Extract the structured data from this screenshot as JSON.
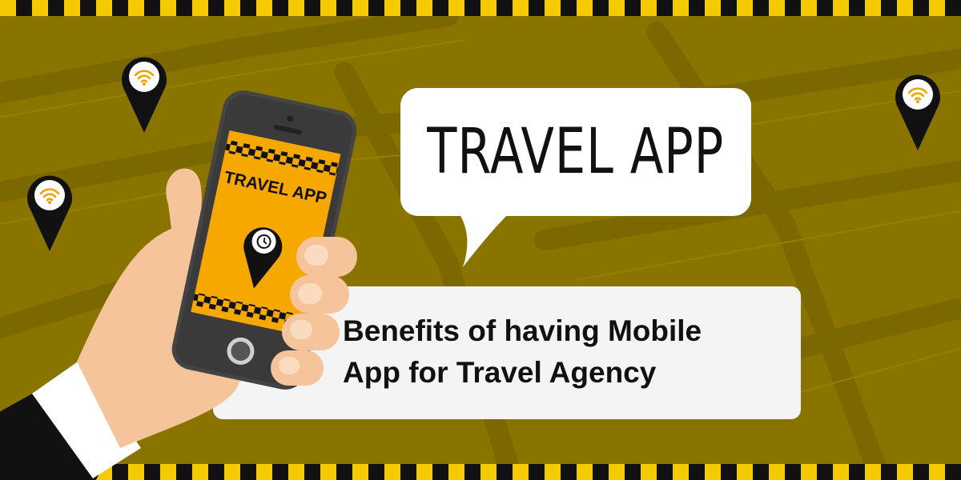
{
  "colors": {
    "background": "#8a7400",
    "accent_yellow": "#f5cb00",
    "wifi_orange": "#f0a400",
    "dark": "#111111",
    "card": "#f4f4f5",
    "skin": "#f6c49a"
  },
  "icons": [
    "wifi-location-pin-icon",
    "location-pin-icon",
    "clock-icon",
    "home-button-icon"
  ],
  "bubble": {
    "title": "TRAVEL APP"
  },
  "phone": {
    "screen_title": "TRAVEL APP"
  },
  "banner": {
    "line1": "Benefits of having Mobile",
    "line2": "App for Travel Agency"
  }
}
